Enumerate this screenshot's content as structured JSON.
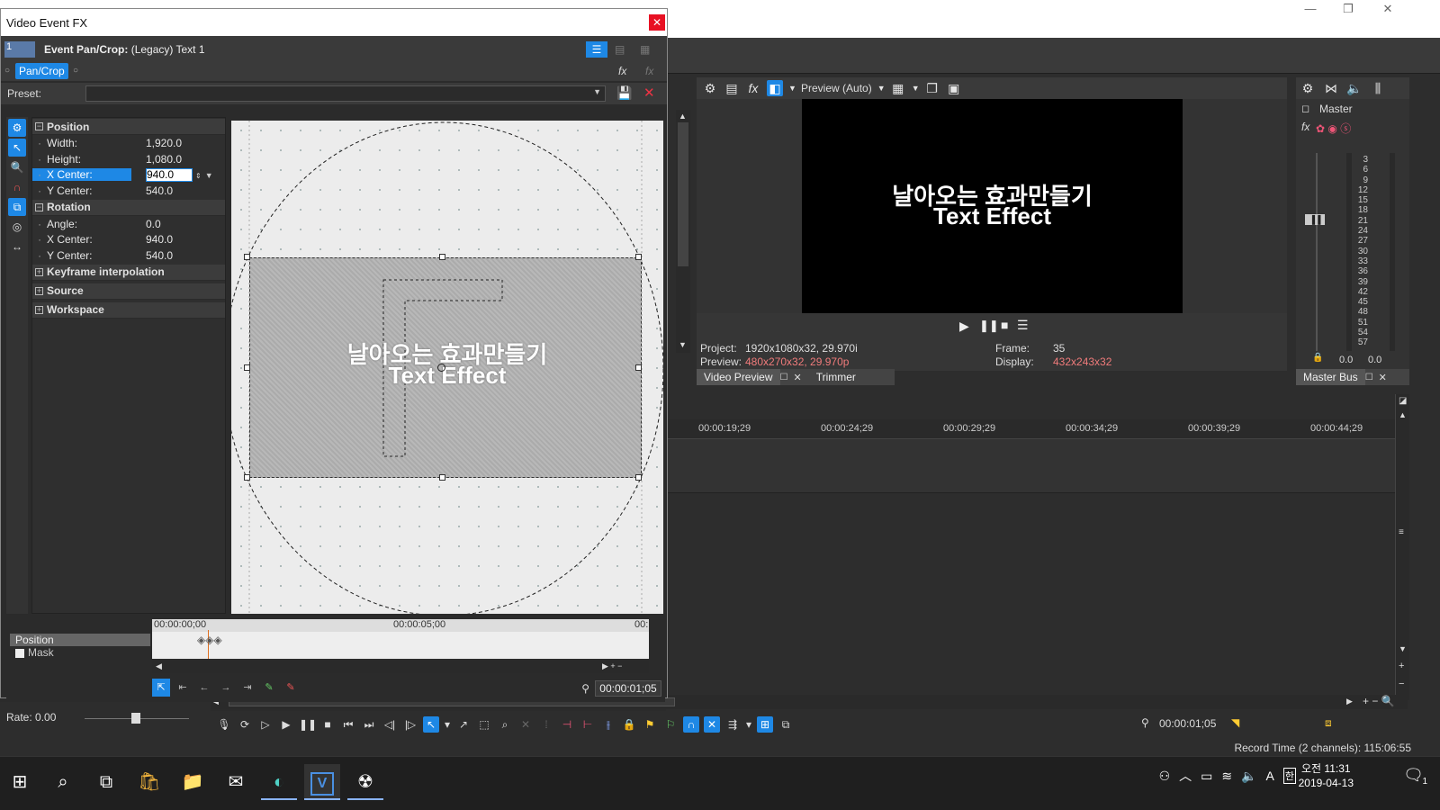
{
  "app": {
    "window_controls": [
      "—",
      "❐",
      "✕"
    ]
  },
  "fx_dialog": {
    "title": "Video Event FX",
    "chain_number": "1",
    "chain_label_bold": "Event Pan/Crop:",
    "chain_label": "(Legacy) Text 1",
    "tab": "Pan/Crop",
    "preset_label": "Preset:",
    "preset_value": "",
    "sections": {
      "position": "Position",
      "rotation": "Rotation",
      "keyframe": "Keyframe interpolation",
      "source": "Source",
      "workspace": "Workspace"
    },
    "position_rows": [
      {
        "key": "Width:",
        "value": "1,920.0"
      },
      {
        "key": "Height:",
        "value": "1,080.0"
      },
      {
        "key": "X Center:",
        "value": "940.0"
      },
      {
        "key": "Y Center:",
        "value": "540.0"
      }
    ],
    "rotation_rows": [
      {
        "key": "Angle:",
        "value": "0.0"
      },
      {
        "key": "X Center:",
        "value": "940.0"
      },
      {
        "key": "Y Center:",
        "value": "540.0"
      }
    ],
    "canvas_text_line1": "날아오는 효과만들기",
    "canvas_text_line2": "Text Effect",
    "keyframes": {
      "tracks": [
        "Position",
        "Mask"
      ],
      "ruler_start": "00:00:00;00",
      "ruler_mid": "00:00:05;00",
      "ruler_end": "00:",
      "time": "00:00:01;05"
    }
  },
  "preview": {
    "mode": "Preview (Auto)",
    "text_line1": "날아오는 효과만들기",
    "text_line2": "Text Effect",
    "project_label": "Project:",
    "project_value": "1920x1080x32, 29.970i",
    "preview_label": "Preview:",
    "preview_value": "480x270x32, 29.970p",
    "frame_label": "Frame:",
    "frame_value": "35",
    "display_label": "Display:",
    "display_value": "432x243x32",
    "tabs": [
      "Video Preview",
      "Trimmer"
    ]
  },
  "master": {
    "label": "Master",
    "scale": [
      "3",
      "6",
      "9",
      "12",
      "15",
      "18",
      "21",
      "24",
      "27",
      "30",
      "33",
      "36",
      "39",
      "42",
      "45",
      "48",
      "51",
      "54",
      "57"
    ],
    "left_level": "0.0",
    "right_level": "0.0",
    "tab": "Master Bus"
  },
  "timeline": {
    "ticks": [
      "00:00:19;29",
      "00:00:24;29",
      "00:00:29;29",
      "00:00:34;29",
      "00:00:39;29",
      "00:00:44;29"
    ],
    "cursor_time": "00:00:01;05",
    "rate": "Rate: 0.00"
  },
  "status": {
    "record_time": "Record Time (2 channels): 115:06:55"
  },
  "taskbar": {
    "time": "오전 11:31",
    "date": "2019-04-13",
    "ime": "A",
    "ime2": "한",
    "notifications": "1"
  }
}
